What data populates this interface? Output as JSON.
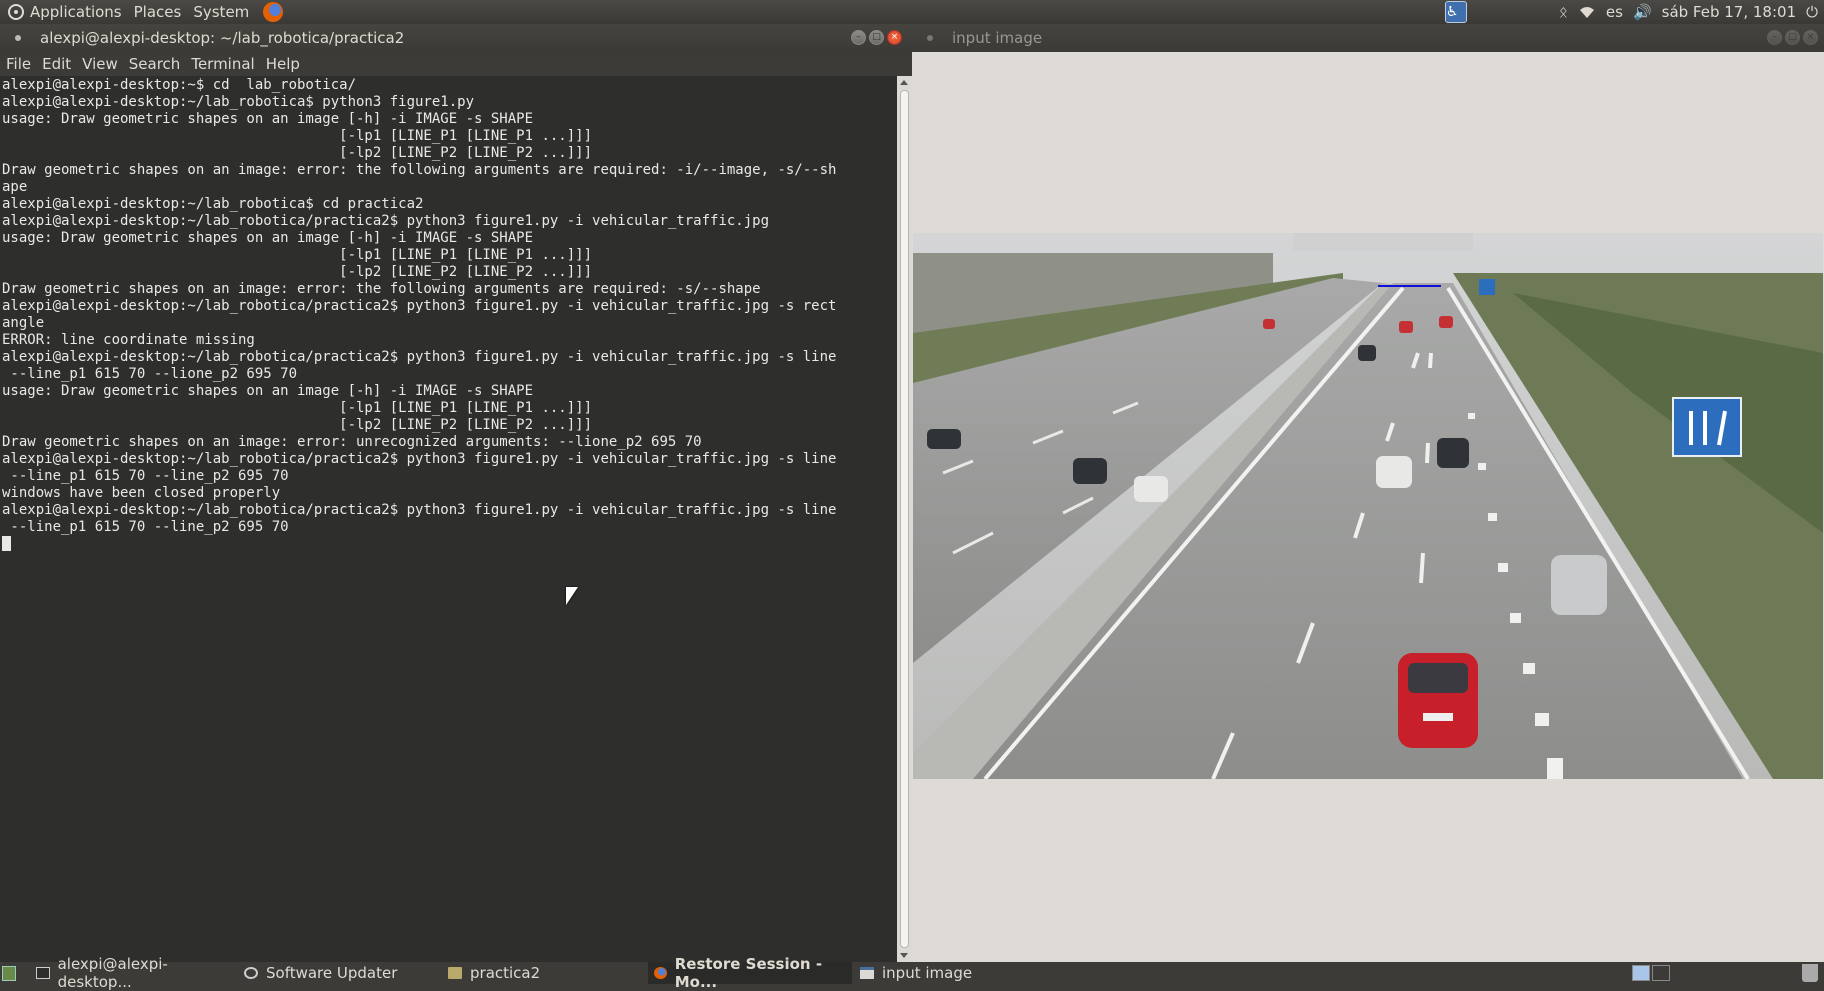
{
  "top_panel": {
    "menus": [
      "Applications",
      "Places",
      "System"
    ],
    "tray": {
      "keyboard_layout": "es",
      "datetime": "sáb Feb 17, 18:01"
    }
  },
  "terminal": {
    "title": "alexpi@alexpi-desktop: ~/lab_robotica/practica2",
    "menu": [
      "File",
      "Edit",
      "View",
      "Search",
      "Terminal",
      "Help"
    ],
    "lines": [
      "alexpi@alexpi-desktop:~$ cd  lab_robotica/",
      "alexpi@alexpi-desktop:~/lab_robotica$ python3 figure1.py",
      "usage: Draw geometric shapes on an image [-h] -i IMAGE -s SHAPE",
      "                                        [-lp1 [LINE_P1 [LINE_P1 ...]]]",
      "                                        [-lp2 [LINE_P2 [LINE_P2 ...]]]",
      "Draw geometric shapes on an image: error: the following arguments are required: -i/--image, -s/--sh",
      "ape",
      "alexpi@alexpi-desktop:~/lab_robotica$ cd practica2",
      "alexpi@alexpi-desktop:~/lab_robotica/practica2$ python3 figure1.py -i vehicular_traffic.jpg",
      "usage: Draw geometric shapes on an image [-h] -i IMAGE -s SHAPE",
      "                                        [-lp1 [LINE_P1 [LINE_P1 ...]]]",
      "                                        [-lp2 [LINE_P2 [LINE_P2 ...]]]",
      "Draw geometric shapes on an image: error: the following arguments are required: -s/--shape",
      "alexpi@alexpi-desktop:~/lab_robotica/practica2$ python3 figure1.py -i vehicular_traffic.jpg -s rect",
      "angle",
      "ERROR: line coordinate missing",
      "alexpi@alexpi-desktop:~/lab_robotica/practica2$ python3 figure1.py -i vehicular_traffic.jpg -s line",
      " --line_p1 615 70 --lione_p2 695 70",
      "usage: Draw geometric shapes on an image [-h] -i IMAGE -s SHAPE",
      "                                        [-lp1 [LINE_P1 [LINE_P1 ...]]]",
      "                                        [-lp2 [LINE_P2 [LINE_P2 ...]]]",
      "Draw geometric shapes on an image: error: unrecognized arguments: --lione_p2 695 70",
      "alexpi@alexpi-desktop:~/lab_robotica/practica2$ python3 figure1.py -i vehicular_traffic.jpg -s line",
      " --line_p1 615 70 --line_p2 695 70",
      "windows have been closed properly",
      "alexpi@alexpi-desktop:~/lab_robotica/practica2$ python3 figure1.py -i vehicular_traffic.jpg -s line",
      " --line_p1 615 70 --line_p2 695 70"
    ]
  },
  "image_window": {
    "title": "input image"
  },
  "taskbar": {
    "tasks": [
      {
        "label": "alexpi@alexpi-desktop...",
        "icon": "terminal-icon"
      },
      {
        "label": "Software Updater",
        "icon": "updater-icon"
      },
      {
        "label": "practica2",
        "icon": "folder-icon"
      },
      {
        "label": "Restore Session - Mo...",
        "icon": "firefox-icon"
      },
      {
        "label": "input image",
        "icon": "window-icon"
      }
    ]
  },
  "colors": {
    "panel": "#3c3b37",
    "terminal_bg": "#2e2e2c",
    "drawn_line": "#1010d8"
  }
}
